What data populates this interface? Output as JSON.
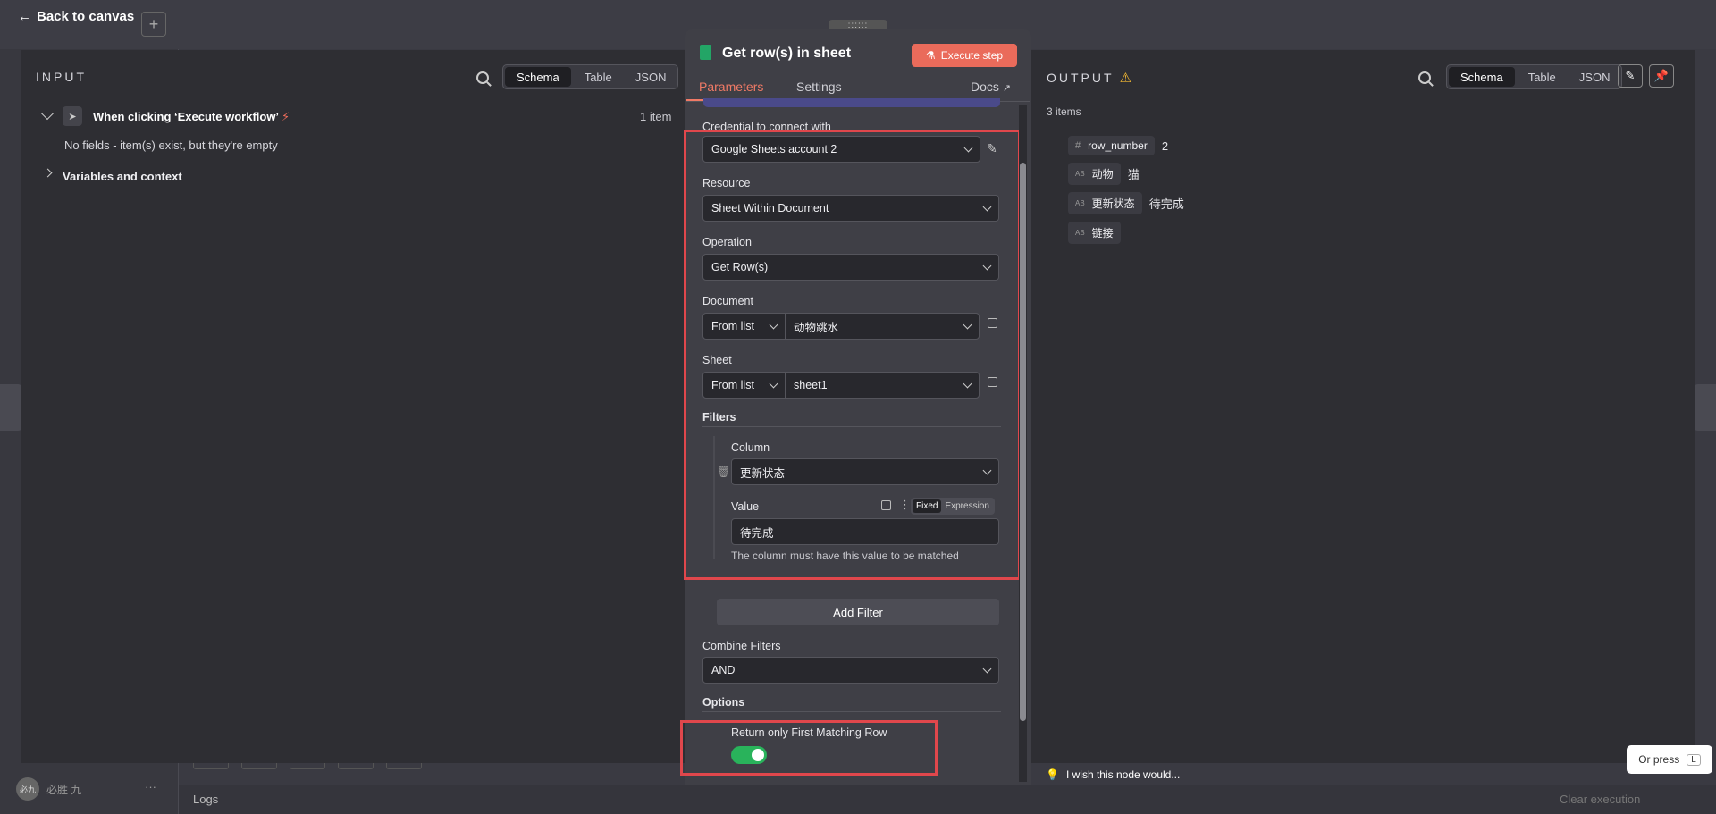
{
  "background": {
    "back_label": "Back to canvas",
    "logs_label": "Logs",
    "clear_execution": "Clear execution",
    "user_name": "必胜 九",
    "user_initials": "必九"
  },
  "input": {
    "title": "INPUT",
    "tabs": [
      "Schema",
      "Table",
      "JSON"
    ],
    "active_tab": "Schema",
    "trigger_label": "When clicking ‘Execute workflow’",
    "item_count": "1 item",
    "empty_message": "No fields - item(s) exist, but they're empty",
    "variables_label": "Variables and context"
  },
  "node": {
    "title": "Get row(s) in sheet",
    "execute_label": "Execute step",
    "tabs": {
      "parameters": "Parameters",
      "settings": "Settings",
      "docs": "Docs"
    },
    "credential_label": "Credential to connect with",
    "credential_value": "Google Sheets account 2",
    "resource_label": "Resource",
    "resource_value": "Sheet Within Document",
    "operation_label": "Operation",
    "operation_value": "Get Row(s)",
    "document_label": "Document",
    "document_mode": "From list",
    "document_value": "动物跳水",
    "sheet_label": "Sheet",
    "sheet_mode": "From list",
    "sheet_value": "sheet1",
    "filters_label": "Filters",
    "column_label": "Column",
    "column_value": "更新状态",
    "value_label": "Value",
    "value_mode_fixed": "Fixed",
    "value_mode_expression": "Expression",
    "value_value": "待完成",
    "value_hint": "The column must have this value to be matched",
    "add_filter": "Add Filter",
    "combine_label": "Combine Filters",
    "combine_value": "AND",
    "options_label": "Options",
    "first_match_label": "Return only First Matching Row",
    "first_match_enabled": true
  },
  "output": {
    "title": "OUTPUT",
    "tabs": [
      "Schema",
      "Table",
      "JSON"
    ],
    "active_tab": "Schema",
    "item_count": "3 items",
    "fields": [
      {
        "type": "#",
        "name": "row_number",
        "value": "2"
      },
      {
        "type": "AB",
        "name": "动物",
        "value": "猫"
      },
      {
        "type": "AB",
        "name": "更新状态",
        "value": "待完成"
      },
      {
        "type": "AB",
        "name": "链接",
        "value": ""
      }
    ],
    "wish_label": "I wish this node would..."
  },
  "tooltip": {
    "text": "Or press",
    "key": "L"
  },
  "colors": {
    "accent": "#f07a66",
    "execute": "#ea6b5b",
    "toggle_on": "#29b35b",
    "highlight": "#e0474c",
    "sheets": "#23a566"
  }
}
